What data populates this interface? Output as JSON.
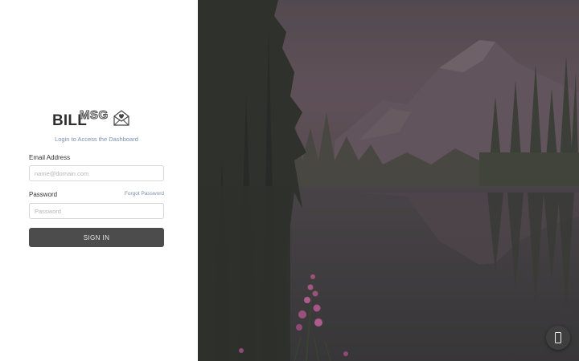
{
  "brand": {
    "logo_text": "BILLMSG"
  },
  "login": {
    "subtitle": "Login to Access the Dashboard",
    "email_label": "Email Address",
    "email_placeholder": "name@domain.com",
    "password_label": "Password",
    "forgot_password": "Forgot Password",
    "password_placeholder": "Password",
    "signin_button": "SIGN IN"
  },
  "background": {
    "scene": "mountain-lake-forest",
    "overlay_color": "#4a4246"
  },
  "widgets": {
    "chat_icon": "phone-icon"
  }
}
